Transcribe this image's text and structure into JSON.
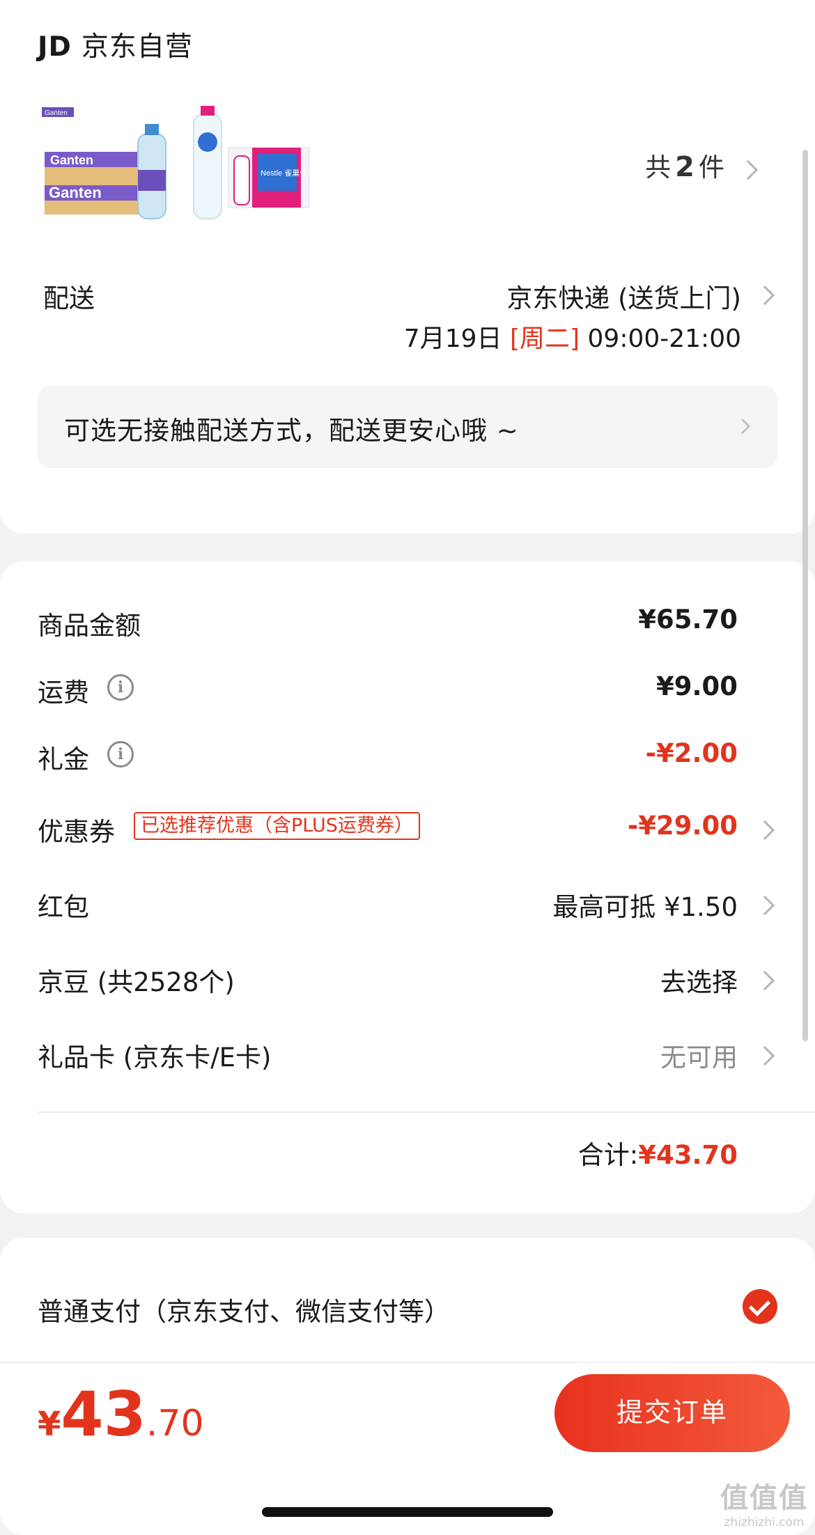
{
  "shop": {
    "logo_text": "JD",
    "name": "京东自营",
    "products": [
      {
        "icon": "ganten-water-pack-image",
        "brand_text": "Ganten",
        "color": "#6b4fbb"
      },
      {
        "icon": "nestle-water-pack-image",
        "brand_text": "Nestle 雀巢优活",
        "color": "#e0207a"
      }
    ],
    "count_prefix": "共",
    "count": "2",
    "count_suffix": "件"
  },
  "delivery": {
    "label": "配送",
    "method": "京东快递 (送货上门)",
    "date": "7月19日",
    "weekday": "[周二]",
    "time": "09:00-21:00"
  },
  "contactless_notice": "可选无接触配送方式，配送更安心哦 ~",
  "amounts": {
    "goods": {
      "label": "商品金额",
      "value": "¥65.70"
    },
    "shipping": {
      "label": "运费",
      "value": "¥9.00"
    },
    "gift_money": {
      "label": "礼金",
      "value": "-¥2.00"
    },
    "coupon": {
      "label": "优惠券",
      "badge": "已选推荐优惠（含PLUS运费券）",
      "value": "-¥29.00"
    },
    "red_packet": {
      "label": "红包",
      "value": "最高可抵 ¥1.50"
    },
    "jd_beans": {
      "label": "京豆 (共2528个)",
      "value": "去选择"
    },
    "gift_card": {
      "label": "礼品卡 (京东卡/E卡)",
      "value": "无可用"
    },
    "total_label": "合计:",
    "total_value": "¥43.70"
  },
  "payment": {
    "option_label": "普通支付（京东支付、微信支付等）",
    "selected": true
  },
  "bottom_bar": {
    "currency": "¥",
    "price_int": "43",
    "price_dec": ".70",
    "submit_label": "提交订单"
  },
  "watermark": {
    "mark": "值值值",
    "url": "zhizhizhi.com"
  },
  "colors": {
    "accent": "#e2341d",
    "background": "#f2f2f2",
    "card": "#ffffff"
  }
}
